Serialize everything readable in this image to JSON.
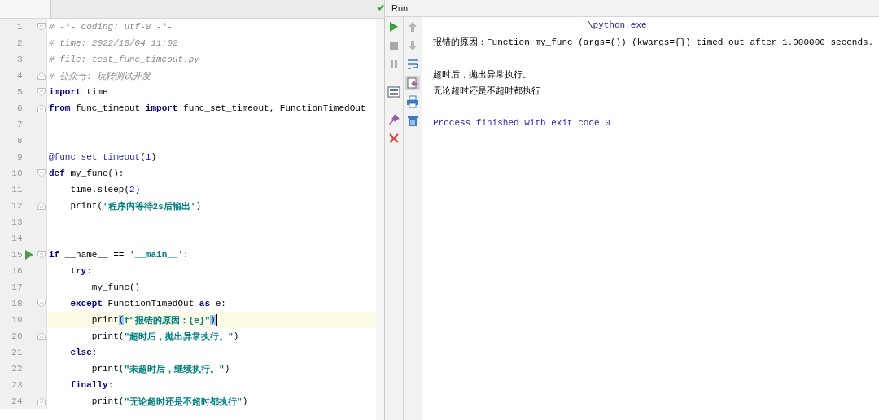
{
  "editor": {
    "lines": [
      {
        "number": "1",
        "gutter": [
          {
            "kind": "fold_start"
          }
        ],
        "current": false,
        "tokens": [
          {
            "kind": "comment",
            "text": "# -*- coding: utf-8 -*-"
          }
        ]
      },
      {
        "number": "2",
        "current": false,
        "tokens": [
          {
            "kind": "comment",
            "text": "# time: 2022/10/04 11:02"
          }
        ]
      },
      {
        "number": "3",
        "current": false,
        "tokens": [
          {
            "kind": "comment",
            "text": "# file: test_func_timeout.py"
          }
        ]
      },
      {
        "number": "4",
        "gutter": [
          {
            "kind": "fold_end"
          }
        ],
        "current": false,
        "tokens": [
          {
            "kind": "comment",
            "text": "# 公众号: 玩转测试开发"
          }
        ]
      },
      {
        "number": "5",
        "gutter": [
          {
            "kind": "fold_start"
          }
        ],
        "current": false,
        "tokens": [
          {
            "kind": "keyword",
            "text": "import"
          },
          {
            "kind": "plain",
            "text": " time"
          }
        ]
      },
      {
        "number": "6",
        "gutter": [
          {
            "kind": "fold_end"
          }
        ],
        "current": false,
        "tokens": [
          {
            "kind": "keyword",
            "text": "from"
          },
          {
            "kind": "plain",
            "text": " func_timeout "
          },
          {
            "kind": "keyword",
            "text": "import"
          },
          {
            "kind": "plain",
            "text": " func_set_timeout, FunctionTimedOut"
          }
        ]
      },
      {
        "number": "7",
        "current": false
      },
      {
        "number": "8",
        "current": false
      },
      {
        "number": "9",
        "current": false,
        "tokens": [
          {
            "kind": "decorator",
            "text": "@func_set_timeout"
          },
          {
            "kind": "plain",
            "text": "("
          },
          {
            "kind": "number",
            "text": "1"
          },
          {
            "kind": "plain",
            "text": ")"
          }
        ]
      },
      {
        "number": "10",
        "gutter": [
          {
            "kind": "fold_start"
          }
        ],
        "current": false,
        "tokens": [
          {
            "kind": "keyword",
            "text": "def"
          },
          {
            "kind": "plain",
            "text": " my_func():"
          }
        ]
      },
      {
        "number": "11",
        "current": false,
        "tokens": [
          {
            "kind": "plain",
            "text": "    time.sleep("
          },
          {
            "kind": "number",
            "text": "2"
          },
          {
            "kind": "plain",
            "text": ")"
          }
        ]
      },
      {
        "number": "12",
        "gutter": [
          {
            "kind": "fold_end"
          }
        ],
        "current": false,
        "tokens": [
          {
            "kind": "plain",
            "text": "    print("
          },
          {
            "kind": "string",
            "text": "'程序内等待2s后输出'"
          },
          {
            "kind": "plain",
            "text": ")"
          }
        ]
      },
      {
        "number": "13",
        "current": false
      },
      {
        "number": "14",
        "current": false
      },
      {
        "number": "15",
        "gutter": [
          {
            "kind": "run"
          },
          {
            "kind": "fold_start"
          }
        ],
        "current": false,
        "tokens": [
          {
            "kind": "keyword",
            "text": "if"
          },
          {
            "kind": "plain",
            "text": " __name__ == "
          },
          {
            "kind": "string",
            "text": "'__main__'"
          },
          {
            "kind": "plain",
            "text": ":"
          }
        ]
      },
      {
        "number": "16",
        "current": false,
        "tokens": [
          {
            "kind": "keyword",
            "text": "    try"
          },
          {
            "kind": "plain",
            "text": ":"
          }
        ]
      },
      {
        "number": "17",
        "current": false,
        "tokens": [
          {
            "kind": "plain",
            "text": "        my_func()"
          }
        ]
      },
      {
        "number": "18",
        "gutter": [
          {
            "kind": "fold_start"
          }
        ],
        "current": false,
        "tokens": [
          {
            "kind": "keyword",
            "text": "    except"
          },
          {
            "kind": "plain",
            "text": " FunctionTimedOut "
          },
          {
            "kind": "keyword",
            "text": "as"
          },
          {
            "kind": "plain",
            "text": " e:"
          }
        ]
      },
      {
        "number": "19",
        "current": true,
        "tokens": [
          {
            "kind": "plain",
            "text": "        print"
          },
          {
            "kind": "brace_match",
            "text": "("
          },
          {
            "kind": "string",
            "text": "f\"报错的原因：{e}\""
          },
          {
            "kind": "brace_match",
            "text": ")"
          }
        ]
      },
      {
        "number": "20",
        "gutter": [
          {
            "kind": "fold_end"
          }
        ],
        "current": false,
        "tokens": [
          {
            "kind": "plain",
            "text": "        print("
          },
          {
            "kind": "string",
            "text": "\"超时后，抛出异常执行。\""
          },
          {
            "kind": "plain",
            "text": ")"
          }
        ]
      },
      {
        "number": "21",
        "current": false,
        "tokens": [
          {
            "kind": "keyword",
            "text": "    else"
          },
          {
            "kind": "plain",
            "text": ":"
          }
        ]
      },
      {
        "number": "22",
        "current": false,
        "tokens": [
          {
            "kind": "plain",
            "text": "        print("
          },
          {
            "kind": "string",
            "text": "\"未超时后，继续执行。\""
          },
          {
            "kind": "plain",
            "text": ")"
          }
        ]
      },
      {
        "number": "23",
        "current": false,
        "tokens": [
          {
            "kind": "keyword",
            "text": "    finally"
          },
          {
            "kind": "plain",
            "text": ":"
          }
        ]
      },
      {
        "number": "24",
        "gutter": [
          {
            "kind": "fold_end"
          }
        ],
        "current": false,
        "tokens": [
          {
            "kind": "plain",
            "text": "        print("
          },
          {
            "kind": "string",
            "text": "\"无论超时还是不超时都执行\""
          },
          {
            "kind": "plain",
            "text": ")"
          }
        ]
      }
    ]
  },
  "run_panel": {
    "label": "Run:",
    "toolbar_left": [
      {
        "kind": "run"
      },
      {
        "kind": "stop"
      },
      {
        "kind": "pause"
      },
      {
        "kind": "layout"
      },
      {
        "kind": "pin"
      },
      {
        "kind": "close"
      }
    ],
    "toolbar_right": [
      {
        "kind": "up",
        "selected": false
      },
      {
        "kind": "down",
        "selected": false
      },
      {
        "kind": "wrap",
        "selected": false
      },
      {
        "kind": "scroll_end",
        "selected": true
      },
      {
        "kind": "print",
        "selected": false
      },
      {
        "kind": "trash",
        "selected": false
      }
    ],
    "console": [
      {
        "kind": "command",
        "text": "\\python.exe"
      },
      {
        "kind": "output",
        "text": "报错的原因：Function my_func (args=()) (kwargs={}) timed out after 1.000000 seconds."
      },
      {
        "kind": "blank"
      },
      {
        "kind": "output",
        "text": "超时后，抛出异常执行。"
      },
      {
        "kind": "output",
        "text": "无论超时还是不超时都执行"
      },
      {
        "kind": "blank"
      },
      {
        "kind": "exit",
        "text": "Process finished with exit code 0"
      }
    ]
  }
}
